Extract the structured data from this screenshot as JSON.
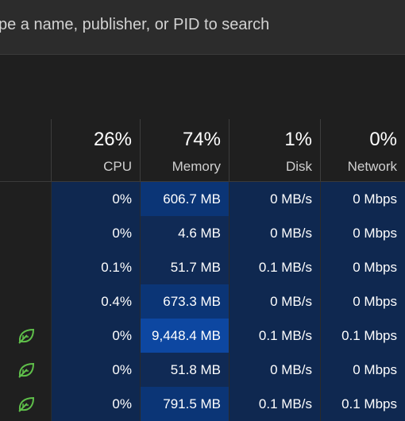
{
  "search": {
    "placeholder": "ype a name, publisher, or PID to search"
  },
  "columns": [
    {
      "id": "cpu",
      "percent": "26%",
      "label": "CPU"
    },
    {
      "id": "memory",
      "percent": "74%",
      "label": "Memory"
    },
    {
      "id": "disk",
      "percent": "1%",
      "label": "Disk"
    },
    {
      "id": "network",
      "percent": "0%",
      "label": "Network"
    }
  ],
  "rows": [
    {
      "eco": false,
      "cpu": "0%",
      "memory": "606.7 MB",
      "disk": "0 MB/s",
      "network": "0 Mbps"
    },
    {
      "eco": false,
      "cpu": "0%",
      "memory": "4.6 MB",
      "disk": "0 MB/s",
      "network": "0 Mbps"
    },
    {
      "eco": false,
      "cpu": "0.1%",
      "memory": "51.7 MB",
      "disk": "0.1 MB/s",
      "network": "0 Mbps"
    },
    {
      "eco": false,
      "cpu": "0.4%",
      "memory": "673.3 MB",
      "disk": "0 MB/s",
      "network": "0 Mbps"
    },
    {
      "eco": true,
      "cpu": "0%",
      "memory": "9,448.4 MB",
      "disk": "0.1 MB/s",
      "network": "0.1 Mbps"
    },
    {
      "eco": true,
      "cpu": "0%",
      "memory": "51.8 MB",
      "disk": "0 MB/s",
      "network": "0 Mbps"
    },
    {
      "eco": true,
      "cpu": "0%",
      "memory": "791.5 MB",
      "disk": "0.1 MB/s",
      "network": "0.1 Mbps"
    }
  ],
  "heat_colors": {
    "cpu": "#0f2850",
    "memory": [
      "#0b3576",
      "#102a55",
      "#102a55",
      "#0b3576",
      "#0d47a1",
      "#102a55",
      "#0b3576"
    ],
    "disk": "#0f2850",
    "network": "#0f2850"
  },
  "icons": {
    "eco": "leaf-icon"
  }
}
